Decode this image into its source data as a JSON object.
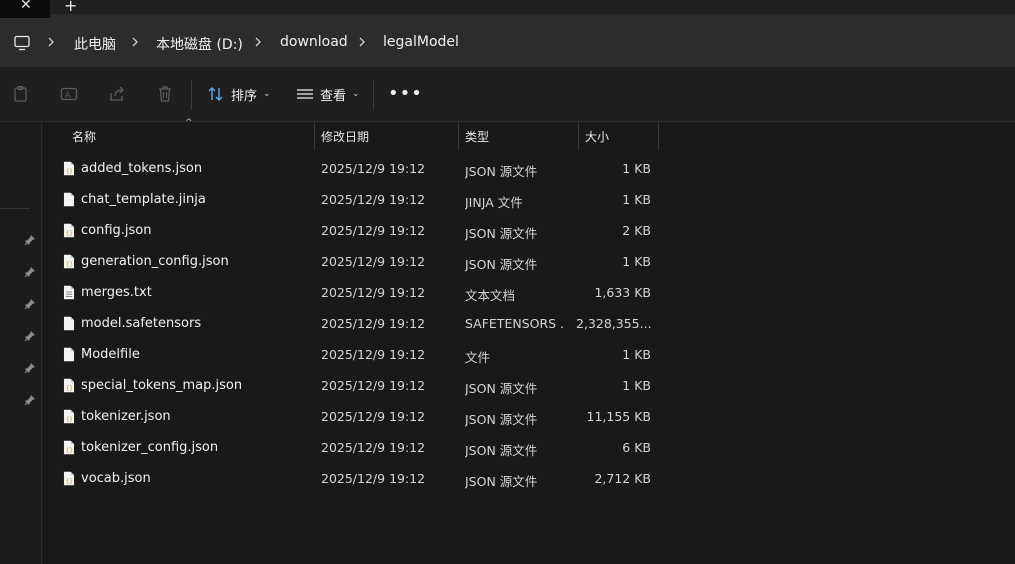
{
  "tabs": {
    "close_glyph": "✕",
    "new_glyph": "+"
  },
  "breadcrumb": {
    "items": [
      "此电脑",
      "本地磁盘 (D:)",
      "download",
      "legalModel"
    ]
  },
  "toolbar": {
    "sort_label": "排序",
    "view_label": "查看",
    "more_label": "•••",
    "chevron": "⌄"
  },
  "columns": {
    "name": "名称",
    "date": "修改日期",
    "type": "类型",
    "size": "大小",
    "sort_indicator": "^"
  },
  "files": [
    {
      "name": "added_tokens.json",
      "date": "2025/12/9 19:12",
      "type": "JSON 源文件",
      "size": "1 KB",
      "icon": "json-file-icon"
    },
    {
      "name": "chat_template.jinja",
      "date": "2025/12/9 19:12",
      "type": "JINJA 文件",
      "size": "1 KB",
      "icon": "blank-file-icon"
    },
    {
      "name": "config.json",
      "date": "2025/12/9 19:12",
      "type": "JSON 源文件",
      "size": "2 KB",
      "icon": "json-file-icon"
    },
    {
      "name": "generation_config.json",
      "date": "2025/12/9 19:12",
      "type": "JSON 源文件",
      "size": "1 KB",
      "icon": "json-file-icon"
    },
    {
      "name": "merges.txt",
      "date": "2025/12/9 19:12",
      "type": "文本文档",
      "size": "1,633 KB",
      "icon": "text-file-icon"
    },
    {
      "name": "model.safetensors",
      "date": "2025/12/9 19:12",
      "type": "SAFETENSORS ...",
      "size": "2,328,355...",
      "icon": "blank-file-icon"
    },
    {
      "name": "Modelfile",
      "date": "2025/12/9 19:12",
      "type": "文件",
      "size": "1 KB",
      "icon": "blank-file-icon"
    },
    {
      "name": "special_tokens_map.json",
      "date": "2025/12/9 19:12",
      "type": "JSON 源文件",
      "size": "1 KB",
      "icon": "json-file-icon"
    },
    {
      "name": "tokenizer.json",
      "date": "2025/12/9 19:12",
      "type": "JSON 源文件",
      "size": "11,155 KB",
      "icon": "json-file-icon"
    },
    {
      "name": "tokenizer_config.json",
      "date": "2025/12/9 19:12",
      "type": "JSON 源文件",
      "size": "6 KB",
      "icon": "json-file-icon"
    },
    {
      "name": "vocab.json",
      "date": "2025/12/9 19:12",
      "type": "JSON 源文件",
      "size": "2,712 KB",
      "icon": "json-file-icon"
    }
  ]
}
